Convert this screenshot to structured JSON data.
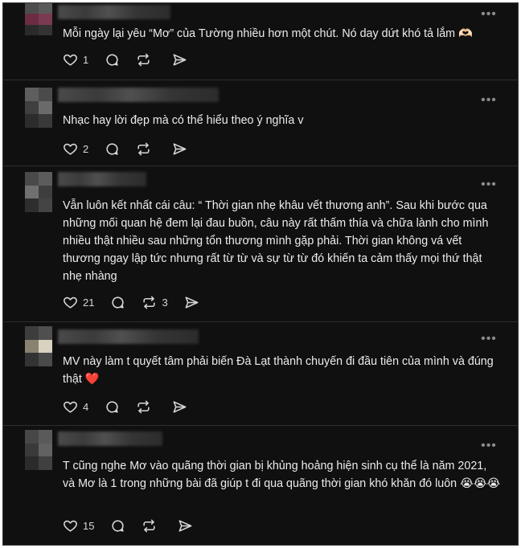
{
  "posts": [
    {
      "text": "Mỗi ngày lại yêu “Mơ” của Tường nhiều hơn một chút. Nó day dứt khó tả lắm 🫶🏻",
      "likes": "1",
      "reposts": ""
    },
    {
      "text": "Nhạc hay lời đẹp mà có thể hiểu theo ý nghĩa v",
      "likes": "2",
      "reposts": ""
    },
    {
      "text": "Vẫn luôn kết nhất cái câu: “ Thời gian nhẹ khâu vết thương anh”. Sau khi bước qua những mối quan hệ đem lại đau buồn, câu này rất thấm thía và chữa lành cho mình nhiều thật nhiều sau những tổn thương mình gặp phải. Thời gian không vá vết thương ngay lập tức nhưng rất từ từ và sự từ từ đó khiến ta cảm thấy mọi thứ thật nhẹ nhàng",
      "likes": "21",
      "reposts": "3"
    },
    {
      "text": "MV này làm t quyết tâm phải biến Đà Lạt thành chuyến đi đầu tiên của mình và đúng thật ❤️",
      "likes": "4",
      "reposts": ""
    },
    {
      "text": "T cũng nghe Mơ vào quãng thời gian bị khủng hoảng hiện sinh cụ thể là năm 2021, và Mơ là 1 trong những bài đã giúp t đi qua quãng thời gian khó khăn đó luôn 😭😭😭",
      "likes": "15",
      "reposts": ""
    }
  ],
  "icons": {
    "like": "heart-icon",
    "reply": "comment-icon",
    "repost": "repost-icon",
    "share": "share-icon",
    "more": "more-options-icon"
  },
  "colors": {
    "background": "#101010",
    "text": "#ececec",
    "icon": "#d6d6d6",
    "divider": "#2e2e2e",
    "heart_emoji": "#e8283a"
  }
}
